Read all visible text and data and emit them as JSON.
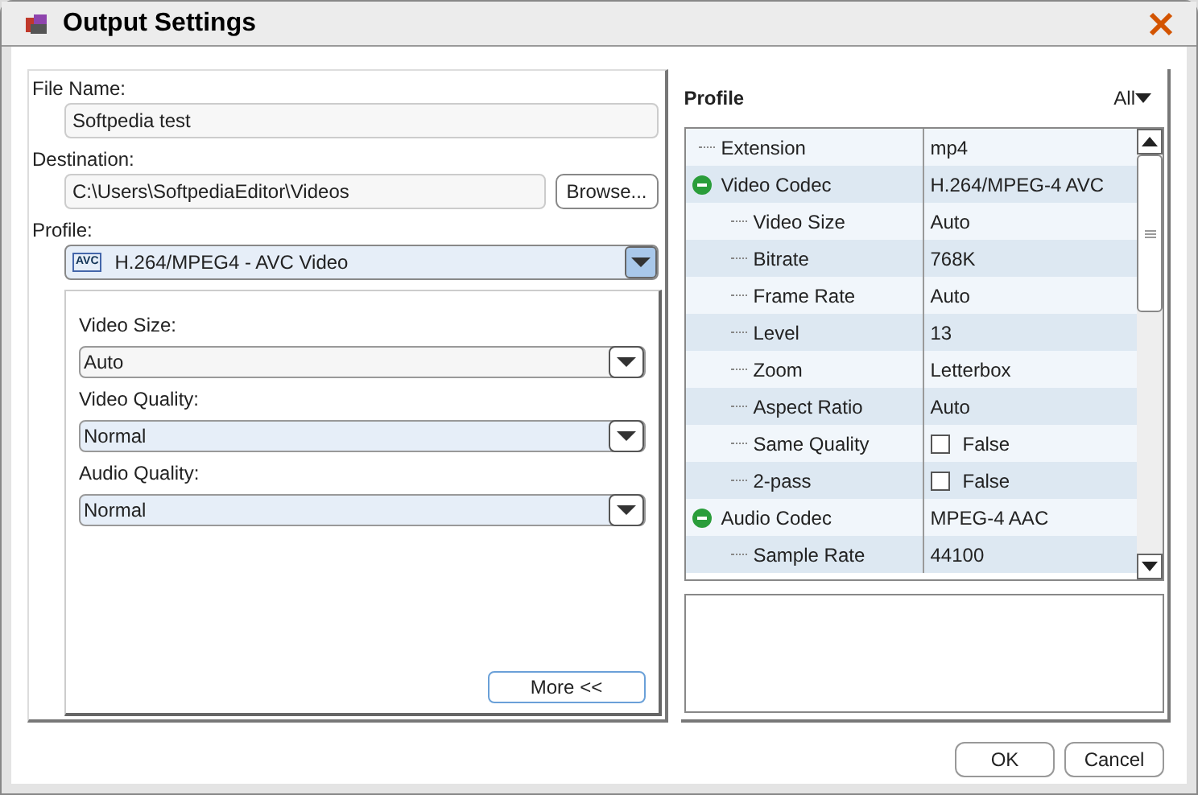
{
  "window": {
    "title": "Output Settings"
  },
  "file_name": {
    "label": "File Name:",
    "value": "Softpedia test"
  },
  "destination": {
    "label": "Destination:",
    "value": "C:\\Users\\SoftpediaEditor\\Videos",
    "button": "Browse..."
  },
  "profile": {
    "label": "Profile:",
    "value": "H.264/MPEG4 - AVC Video",
    "badge": "AVC"
  },
  "options": [
    {
      "label": "Video Size:",
      "value": "Auto",
      "highlighted": false
    },
    {
      "label": "Video Quality:",
      "value": "Normal",
      "highlighted": true
    },
    {
      "label": "Audio Quality:",
      "value": "Normal",
      "highlighted": true
    }
  ],
  "more_button": "More <<",
  "profile_panel": {
    "title": "Profile",
    "filter": "All"
  },
  "properties": [
    {
      "name": "Extension",
      "value": "mp4",
      "kind": "text"
    },
    {
      "name": "Video Codec",
      "value": "H.264/MPEG-4 AVC",
      "kind": "text",
      "expanded": true,
      "children": [
        {
          "name": "Video Size",
          "value": "Auto",
          "kind": "text"
        },
        {
          "name": "Bitrate",
          "value": "768K",
          "kind": "text"
        },
        {
          "name": "Frame Rate",
          "value": "Auto",
          "kind": "text"
        },
        {
          "name": "Level",
          "value": "13",
          "kind": "text"
        },
        {
          "name": "Zoom",
          "value": "Letterbox",
          "kind": "text"
        },
        {
          "name": "Aspect Ratio",
          "value": "Auto",
          "kind": "text"
        },
        {
          "name": "Same Quality",
          "value": "False",
          "kind": "checkbox",
          "checked": false
        },
        {
          "name": "2-pass",
          "value": "False",
          "kind": "checkbox",
          "checked": false
        }
      ]
    },
    {
      "name": "Audio Codec",
      "value": "MPEG-4 AAC",
      "kind": "text",
      "expanded": true,
      "children": [
        {
          "name": "Sample Rate",
          "value": "44100",
          "kind": "text"
        }
      ]
    }
  ],
  "buttons": [
    "OK",
    "Cancel"
  ]
}
